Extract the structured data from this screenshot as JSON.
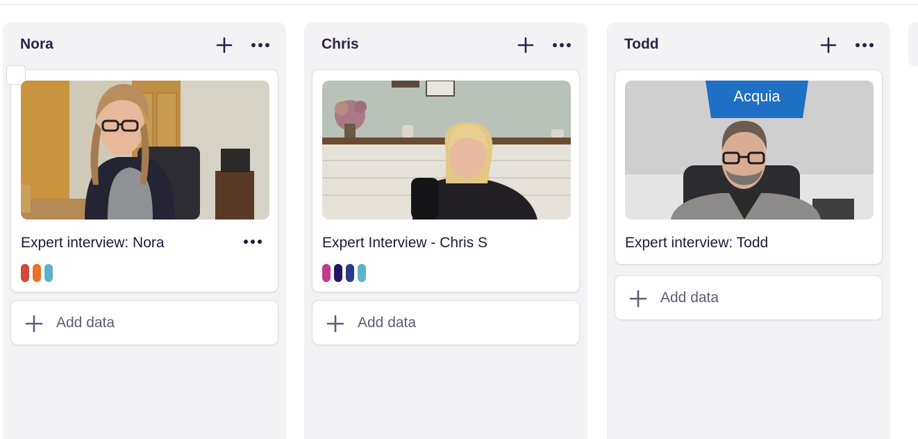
{
  "columns": [
    {
      "title": "Nora",
      "add_icon": "plus-icon",
      "more_icon": "ellipsis-icon",
      "card": {
        "title": "Expert interview: Nora",
        "has_menu": true,
        "has_select_box": true,
        "tags": [
          "#cf4a37",
          "#e8722b",
          "#5fb3c8"
        ]
      },
      "add_data_label": "Add data"
    },
    {
      "title": "Chris",
      "add_icon": "plus-icon",
      "more_icon": "ellipsis-icon",
      "card": {
        "title": "Expert Interview - Chris S",
        "has_menu": false,
        "tags": [
          "#c23b8e",
          "#261566",
          "#283c8f",
          "#5fb3c8"
        ]
      },
      "add_data_label": "Add data"
    },
    {
      "title": "Todd",
      "add_icon": "plus-icon",
      "more_icon": "ellipsis-icon",
      "card": {
        "title": "Expert interview: Todd",
        "has_menu": false,
        "thumbnail_sign_text": "Acquia",
        "tags": []
      },
      "add_data_label": "Add data"
    }
  ],
  "colors": {
    "column_bg": "#f3f3f6",
    "card_border": "#dedce6",
    "text_primary": "#2b2246",
    "text_muted": "#5f5a74"
  }
}
